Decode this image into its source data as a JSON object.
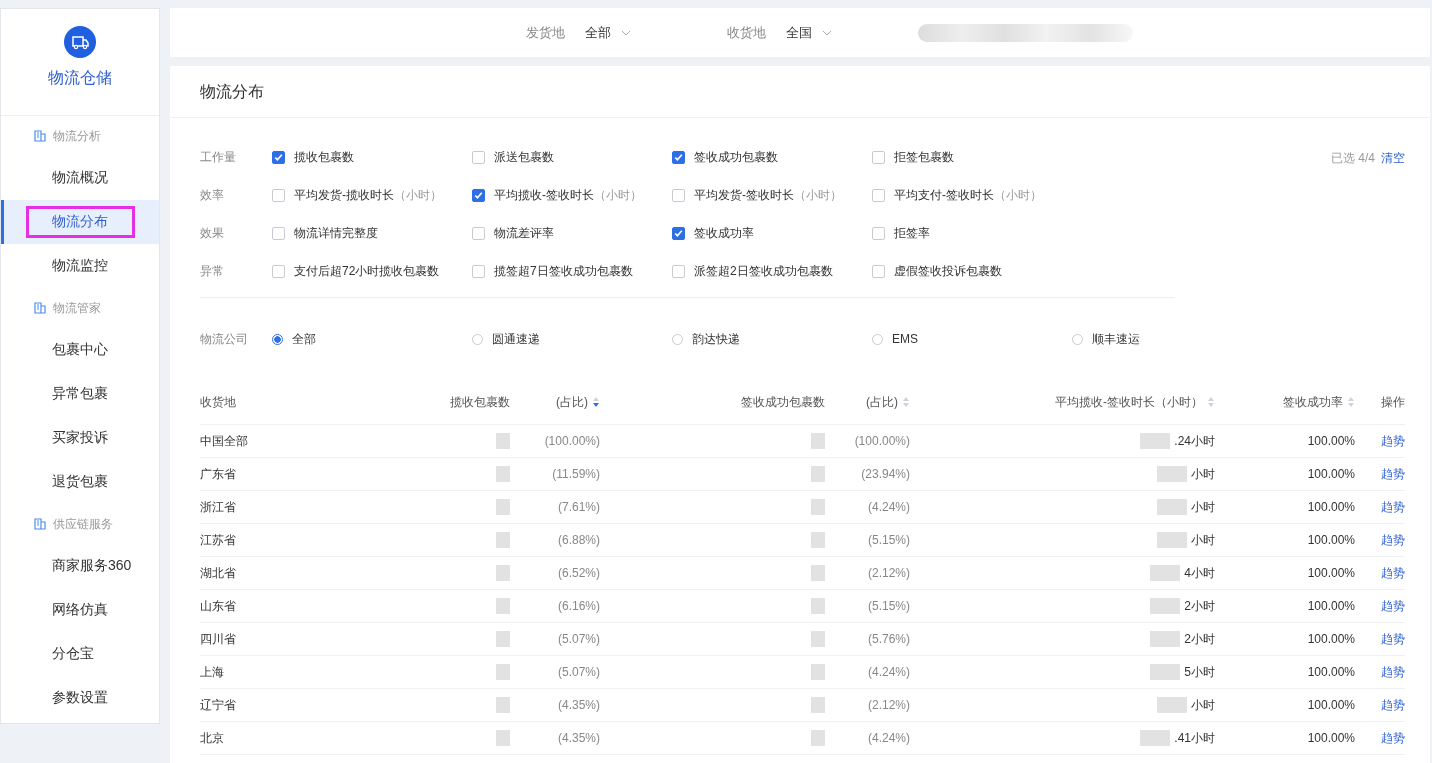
{
  "sidebar": {
    "title": "物流仓储",
    "groups": [
      {
        "title": "物流分析",
        "items": [
          {
            "label": "物流概况",
            "selected": false,
            "annotated": false
          },
          {
            "label": "物流分布",
            "selected": true,
            "annotated": true
          },
          {
            "label": "物流监控",
            "selected": false,
            "annotated": false
          }
        ]
      },
      {
        "title": "物流管家",
        "items": [
          {
            "label": "包裹中心",
            "selected": false,
            "annotated": false
          },
          {
            "label": "异常包裹",
            "selected": false,
            "annotated": false
          },
          {
            "label": "买家投诉",
            "selected": false,
            "annotated": false
          },
          {
            "label": "退货包裹",
            "selected": false,
            "annotated": false
          }
        ]
      },
      {
        "title": "供应链服务",
        "items": [
          {
            "label": "商家服务360",
            "selected": false,
            "annotated": false
          },
          {
            "label": "网络仿真",
            "selected": false,
            "annotated": false
          },
          {
            "label": "分仓宝",
            "selected": false,
            "annotated": false
          },
          {
            "label": "参数设置",
            "selected": false,
            "annotated": false
          }
        ]
      }
    ]
  },
  "top_bar": {
    "filters": [
      {
        "label": "发货地",
        "value": "全部"
      },
      {
        "label": "收货地",
        "value": "全国"
      }
    ]
  },
  "page": {
    "title": "物流分布",
    "selected_count": {
      "label": "已选 4/4",
      "action": "清空"
    },
    "metric_groups": [
      {
        "label": "工作量",
        "options": [
          {
            "label": "揽收包裹数",
            "checked": true
          },
          {
            "label": "派送包裹数",
            "checked": false
          },
          {
            "label": "签收成功包裹数",
            "checked": true
          },
          {
            "label": "拒签包裹数",
            "checked": false
          }
        ]
      },
      {
        "label": "效率",
        "options": [
          {
            "label": "平均发货-揽收时长",
            "unit": "（小时）",
            "checked": false
          },
          {
            "label": "平均揽收-签收时长",
            "unit": "（小时）",
            "checked": true
          },
          {
            "label": "平均发货-签收时长",
            "unit": "（小时）",
            "checked": false
          },
          {
            "label": "平均支付-签收时长",
            "unit": "（小时）",
            "checked": false
          }
        ]
      },
      {
        "label": "效果",
        "options": [
          {
            "label": "物流详情完整度",
            "checked": false
          },
          {
            "label": "物流差评率",
            "checked": false
          },
          {
            "label": "签收成功率",
            "checked": true
          },
          {
            "label": "拒签率",
            "checked": false
          }
        ]
      },
      {
        "label": "异常",
        "options": [
          {
            "label": "支付后超72小时揽收包裹数",
            "checked": false
          },
          {
            "label": "揽签超7日签收成功包裹数",
            "checked": false
          },
          {
            "label": "派签超2日签收成功包裹数",
            "checked": false
          },
          {
            "label": "虚假签收投诉包裹数",
            "checked": false
          }
        ]
      }
    ],
    "company": {
      "label": "物流公司",
      "options": [
        {
          "label": "全部",
          "selected": true
        },
        {
          "label": "圆通速递",
          "selected": false
        },
        {
          "label": "韵达快递",
          "selected": false
        },
        {
          "label": "EMS",
          "selected": false
        },
        {
          "label": "顺丰速运",
          "selected": false
        }
      ]
    },
    "table": {
      "columns": [
        {
          "label": "收货地"
        },
        {
          "label": "揽收包裹数"
        },
        {
          "label": "(占比)",
          "sorted": true
        },
        {
          "label": "签收成功包裹数"
        },
        {
          "label": "(占比)",
          "sorted": false
        },
        {
          "label": "平均揽收-签收时长（小时）",
          "sorted": false
        },
        {
          "label": "签收成功率",
          "sorted": false
        },
        {
          "label": "操作"
        }
      ],
      "rows": [
        {
          "region": "中国全部",
          "pickup_share": "(100.00%)",
          "signed_share": "(100.00%)",
          "duration": ".24小时",
          "rate": "100.00%",
          "action": "趋势"
        },
        {
          "region": "广东省",
          "pickup_share": "(11.59%)",
          "signed_share": "(23.94%)",
          "duration": "小时",
          "rate": "100.00%",
          "action": "趋势"
        },
        {
          "region": "浙江省",
          "pickup_share": "(7.61%)",
          "signed_share": "(4.24%)",
          "duration": "小时",
          "rate": "100.00%",
          "action": "趋势"
        },
        {
          "region": "江苏省",
          "pickup_share": "(6.88%)",
          "signed_share": "(5.15%)",
          "duration": "小时",
          "rate": "100.00%",
          "action": "趋势"
        },
        {
          "region": "湖北省",
          "pickup_share": "(6.52%)",
          "signed_share": "(2.12%)",
          "duration": "4小时",
          "rate": "100.00%",
          "action": "趋势"
        },
        {
          "region": "山东省",
          "pickup_share": "(6.16%)",
          "signed_share": "(5.15%)",
          "duration": "2小时",
          "rate": "100.00%",
          "action": "趋势"
        },
        {
          "region": "四川省",
          "pickup_share": "(5.07%)",
          "signed_share": "(5.76%)",
          "duration": "2小时",
          "rate": "100.00%",
          "action": "趋势"
        },
        {
          "region": "上海",
          "pickup_share": "(5.07%)",
          "signed_share": "(4.24%)",
          "duration": "5小时",
          "rate": "100.00%",
          "action": "趋势"
        },
        {
          "region": "辽宁省",
          "pickup_share": "(4.35%)",
          "signed_share": "(2.12%)",
          "duration": "小时",
          "rate": "100.00%",
          "action": "趋势"
        },
        {
          "region": "北京",
          "pickup_share": "(4.35%)",
          "signed_share": "(4.24%)",
          "duration": ".41小时",
          "rate": "100.00%",
          "action": "趋势"
        }
      ]
    }
  }
}
